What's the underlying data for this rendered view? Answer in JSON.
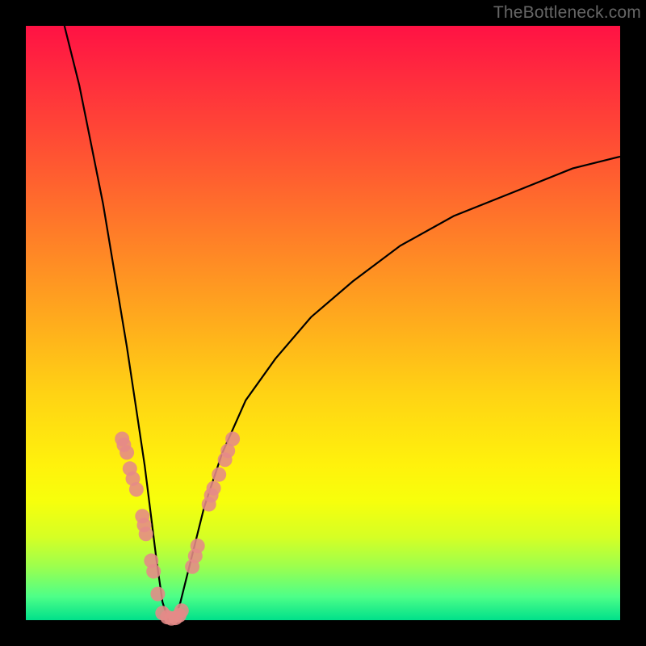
{
  "watermark": "TheBottleneck.com",
  "chart_data": {
    "type": "line",
    "title": "",
    "xlabel": "",
    "ylabel": "",
    "xlim": [
      0,
      100
    ],
    "ylim": [
      0,
      100
    ],
    "background": "rainbow-vertical (red→orange→yellow→green)",
    "curve": {
      "name": "bottleneck-curve",
      "description": "V-shaped curve, steep narrow left arm descending to ~y=0 at x≈24, broad right arm rising to ~y=78 at x=100",
      "points": [
        {
          "x": 6.5,
          "y": 100
        },
        {
          "x": 9,
          "y": 90
        },
        {
          "x": 11,
          "y": 80
        },
        {
          "x": 13,
          "y": 70
        },
        {
          "x": 15,
          "y": 58
        },
        {
          "x": 17,
          "y": 46
        },
        {
          "x": 18.5,
          "y": 36
        },
        {
          "x": 20,
          "y": 26
        },
        {
          "x": 21,
          "y": 18
        },
        {
          "x": 22,
          "y": 10
        },
        {
          "x": 23,
          "y": 3
        },
        {
          "x": 24,
          "y": 0
        },
        {
          "x": 25,
          "y": 0
        },
        {
          "x": 26,
          "y": 3
        },
        {
          "x": 28,
          "y": 11
        },
        {
          "x": 30,
          "y": 19
        },
        {
          "x": 33,
          "y": 28
        },
        {
          "x": 37,
          "y": 37
        },
        {
          "x": 42,
          "y": 44
        },
        {
          "x": 48,
          "y": 51
        },
        {
          "x": 55,
          "y": 57
        },
        {
          "x": 63,
          "y": 63
        },
        {
          "x": 72,
          "y": 68
        },
        {
          "x": 82,
          "y": 72
        },
        {
          "x": 92,
          "y": 76
        },
        {
          "x": 100,
          "y": 78
        }
      ]
    },
    "scatter": {
      "name": "highlighted-points",
      "color": "#e58a87",
      "points": [
        {
          "x": 16.2,
          "y": 30.5
        },
        {
          "x": 16.5,
          "y": 29.5
        },
        {
          "x": 17.0,
          "y": 28.2
        },
        {
          "x": 17.5,
          "y": 25.5
        },
        {
          "x": 18.0,
          "y": 23.8
        },
        {
          "x": 18.6,
          "y": 22.0
        },
        {
          "x": 19.6,
          "y": 17.5
        },
        {
          "x": 19.9,
          "y": 16.0
        },
        {
          "x": 20.2,
          "y": 14.5
        },
        {
          "x": 21.1,
          "y": 10.0
        },
        {
          "x": 21.5,
          "y": 8.2
        },
        {
          "x": 22.2,
          "y": 4.4
        },
        {
          "x": 23.0,
          "y": 1.2
        },
        {
          "x": 23.8,
          "y": 0.5
        },
        {
          "x": 24.5,
          "y": 0.3
        },
        {
          "x": 25.2,
          "y": 0.4
        },
        {
          "x": 25.8,
          "y": 0.8
        },
        {
          "x": 26.2,
          "y": 1.6
        },
        {
          "x": 28.0,
          "y": 9.0
        },
        {
          "x": 28.5,
          "y": 10.8
        },
        {
          "x": 28.9,
          "y": 12.5
        },
        {
          "x": 30.8,
          "y": 19.5
        },
        {
          "x": 31.2,
          "y": 21.0
        },
        {
          "x": 31.6,
          "y": 22.2
        },
        {
          "x": 32.5,
          "y": 24.5
        },
        {
          "x": 33.5,
          "y": 27.0
        },
        {
          "x": 34.0,
          "y": 28.5
        },
        {
          "x": 34.8,
          "y": 30.5
        }
      ]
    }
  }
}
